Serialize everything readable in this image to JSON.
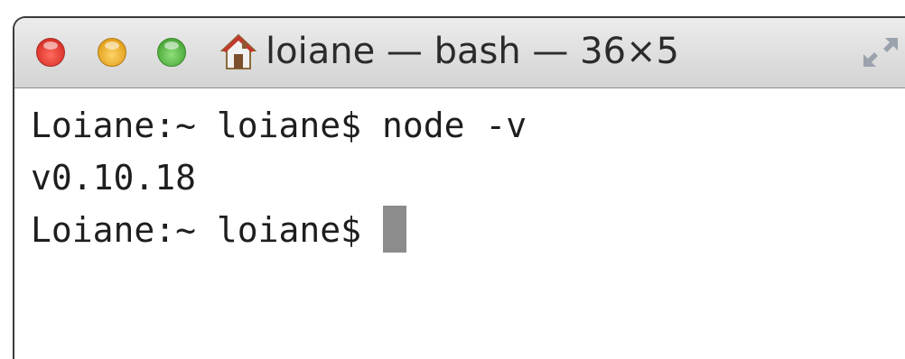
{
  "window": {
    "title": "loiane — bash — 36×5"
  },
  "icons": {
    "close": "close-button",
    "minimize": "minimize-button",
    "zoom": "zoom-button",
    "home": "home-icon",
    "resize": "fullscreen-icon"
  },
  "colors": {
    "close": "#e0443a",
    "minimize": "#f2b632",
    "zoom": "#62c554",
    "cursor": "#8c8c8c"
  },
  "terminal": {
    "lines": [
      {
        "prompt": "Loiane:~ loiane$",
        "command": "node -v"
      },
      {
        "output": "v0.10.18"
      },
      {
        "prompt": "Loiane:~ loiane$",
        "command": ""
      }
    ]
  }
}
